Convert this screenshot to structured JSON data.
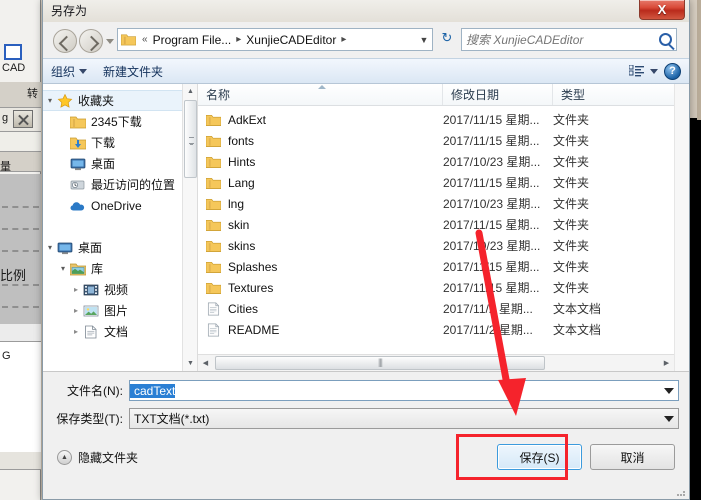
{
  "background": {
    "app_labels": [
      "CAD",
      "转",
      "g",
      "量",
      "比例",
      "G"
    ]
  },
  "dialog": {
    "title": "另存为",
    "close_label": "X",
    "address": {
      "back_icon": "back-arrow-icon",
      "forward_icon": "forward-arrow-icon",
      "folder_icon": "folder-icon",
      "crumb_prefix": "«",
      "crumbs": [
        "Program File...",
        "XunjieCADEditor"
      ],
      "separator": "▸",
      "dropdown_icon": "chevron-down-icon",
      "refresh_icon": "refresh-icon",
      "search_placeholder": "搜索 XunjieCADEditor",
      "search_value": "",
      "search_icon": "magnifier-icon"
    },
    "toolbar": {
      "organize_label": "组织",
      "new_folder_label": "新建文件夹",
      "view_icon": "list-view-icon",
      "view_caret_icon": "chevron-down-icon",
      "help_label": "?",
      "help_icon": "help-icon"
    },
    "nav_pane": {
      "items": [
        {
          "label": "收藏夹",
          "icon": "star-icon",
          "indent": 0,
          "twisty": "▾",
          "selected": true
        },
        {
          "label": "2345下载",
          "icon": "folder-icon",
          "indent": 1,
          "twisty": "",
          "selected": false
        },
        {
          "label": "下载",
          "icon": "download-folder-icon",
          "indent": 1,
          "twisty": "",
          "selected": false
        },
        {
          "label": "桌面",
          "icon": "desktop-icon",
          "indent": 1,
          "twisty": "",
          "selected": false
        },
        {
          "label": "最近访问的位置",
          "icon": "recent-places-icon",
          "indent": 1,
          "twisty": "",
          "selected": false
        },
        {
          "label": "OneDrive",
          "icon": "onedrive-icon",
          "indent": 1,
          "twisty": "",
          "selected": false
        },
        {
          "label": "",
          "icon": "",
          "indent": 0,
          "twisty": "",
          "selected": false
        },
        {
          "label": "桌面",
          "icon": "desktop-icon",
          "indent": 0,
          "twisty": "▾",
          "selected": false
        },
        {
          "label": "库",
          "icon": "library-icon",
          "indent": 1,
          "twisty": "▾",
          "selected": false
        },
        {
          "label": "视频",
          "icon": "video-icon",
          "indent": 2,
          "twisty": "▸",
          "selected": false
        },
        {
          "label": "图片",
          "icon": "picture-icon",
          "indent": 2,
          "twisty": "▸",
          "selected": false
        },
        {
          "label": "文档",
          "icon": "document-icon",
          "indent": 2,
          "twisty": "▸",
          "selected": false
        }
      ]
    },
    "file_list": {
      "columns": [
        "名称",
        "修改日期",
        "类型"
      ],
      "rows": [
        {
          "name": "AdkExt",
          "date": "2017/11/15 星期...",
          "type": "文件夹",
          "icon": "folder-icon"
        },
        {
          "name": "fonts",
          "date": "2017/11/15 星期...",
          "type": "文件夹",
          "icon": "folder-icon"
        },
        {
          "name": "Hints",
          "date": "2017/10/23 星期...",
          "type": "文件夹",
          "icon": "folder-icon"
        },
        {
          "name": "Lang",
          "date": "2017/11/15 星期...",
          "type": "文件夹",
          "icon": "folder-icon"
        },
        {
          "name": "lng",
          "date": "2017/10/23 星期...",
          "type": "文件夹",
          "icon": "folder-icon"
        },
        {
          "name": "skin",
          "date": "2017/11/15 星期...",
          "type": "文件夹",
          "icon": "folder-icon"
        },
        {
          "name": "skins",
          "date": "2017/10/23 星期...",
          "type": "文件夹",
          "icon": "folder-icon"
        },
        {
          "name": "Splashes",
          "date": "2017/11/15 星期...",
          "type": "文件夹",
          "icon": "folder-icon"
        },
        {
          "name": "Textures",
          "date": "2017/11/15 星期...",
          "type": "文件夹",
          "icon": "folder-icon"
        },
        {
          "name": "Cities",
          "date": "2017/11/2 星期...",
          "type": "文本文档",
          "icon": "text-file-icon"
        },
        {
          "name": "README",
          "date": "2017/11/2 星期...",
          "type": "文本文档",
          "icon": "text-file-icon"
        }
      ]
    },
    "form": {
      "filename_label": "文件名(N):",
      "filename_value": "cadText",
      "filetype_label": "保存类型(T):",
      "filetype_value": "TXT文档(*.txt)"
    },
    "footer": {
      "hide_folders_label": "隐藏文件夹",
      "hide_folders_icon": "chevron-up-circle-icon",
      "save_label": "保存(S)",
      "cancel_label": "取消"
    }
  },
  "annotation": {
    "arrow_color": "#f5232c",
    "highlight_color": "#f5232c"
  }
}
